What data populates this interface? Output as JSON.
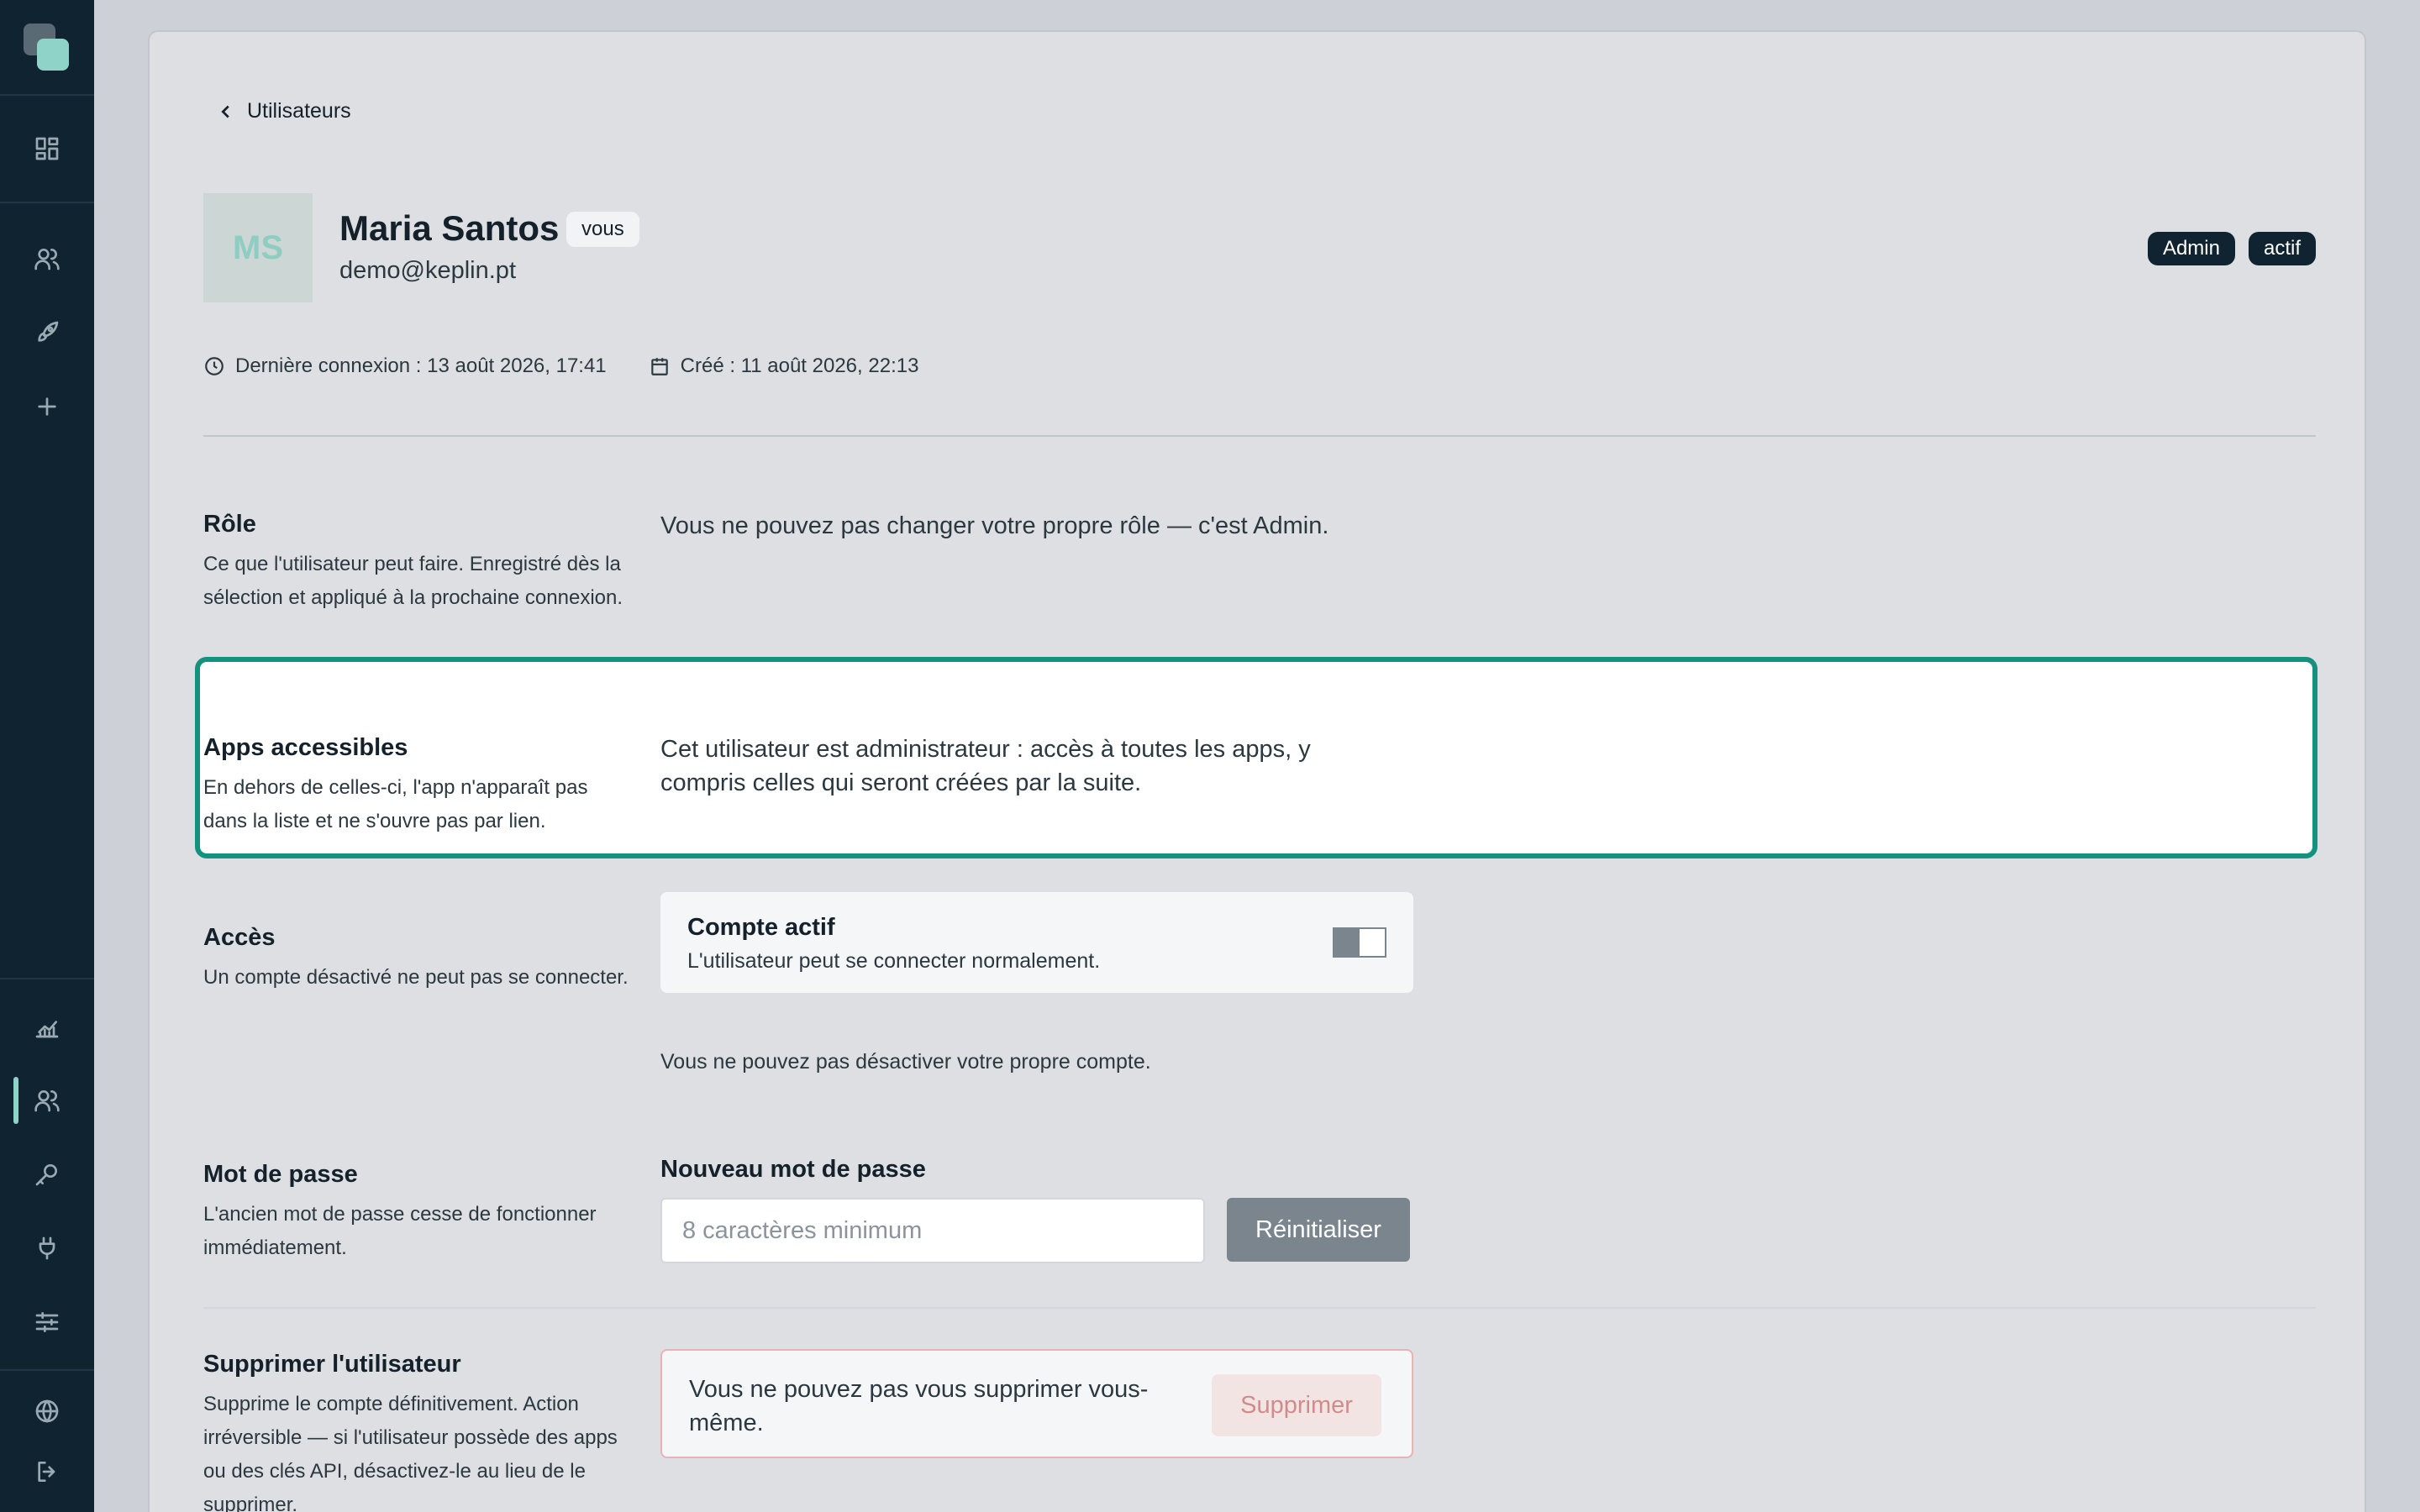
{
  "sidebar": {
    "icons": [
      "logo",
      "dashboard-icon",
      "users-icon",
      "rocket-icon",
      "plus-icon",
      "chart-icon",
      "users-icon",
      "key-icon",
      "plug-icon",
      "sliders-icon",
      "globe-icon",
      "logout-icon"
    ],
    "accent": "#8fd3c8",
    "background": "#0f2430"
  },
  "breadcrumb": {
    "back_label": "Utilisateurs"
  },
  "user": {
    "initials": "MS",
    "name": "Maria Santos",
    "self_badge": "vous",
    "email": "demo@keplin.pt",
    "role_badge": "Admin",
    "status_badge": "actif",
    "last_login": "Dernière connexion : 13 août 2026, 17:41",
    "created": "Créé : 11 août 2026, 22:13"
  },
  "sections": {
    "role": {
      "title": "Rôle",
      "desc": "Ce que l'utilisateur peut faire. Enregistré dès la sélection et appliqué à la prochaine connexion.",
      "value": "Vous ne pouvez pas changer votre propre rôle — c'est Admin."
    },
    "apps": {
      "title": "Apps accessibles",
      "desc": "En dehors de celles-ci, l'app n'apparaît pas dans la liste et ne s'ouvre pas par lien.",
      "value": "Cet utilisateur est administrateur : accès à toutes les apps, y compris celles qui seront créées par la suite."
    },
    "access": {
      "title": "Accès",
      "desc": "Un compte désactivé ne peut pas se connecter.",
      "toggle_title": "Compte actif",
      "toggle_sub": "L'utilisateur peut se connecter normalement.",
      "note": "Vous ne pouvez pas désactiver votre propre compte."
    },
    "password": {
      "title": "Mot de passe",
      "desc": "L'ancien mot de passe cesse de fonctionner immédiatement.",
      "field_label": "Nouveau mot de passe",
      "placeholder": "8 caractères minimum",
      "value": "",
      "button": "Réinitialiser"
    },
    "delete": {
      "title": "Supprimer l'utilisateur",
      "desc": "Supprime le compte définitivement. Action irréversible — si l'utilisateur possède des apps ou des clés API, désactivez-le au lieu de le supprimer.",
      "message": "Vous ne pouvez pas vous supprimer vous-même.",
      "button": "Supprimer"
    }
  },
  "colors": {
    "highlight": "#14917f",
    "danger_border": "#e9b3b3",
    "danger_text": "#d08b8b"
  }
}
